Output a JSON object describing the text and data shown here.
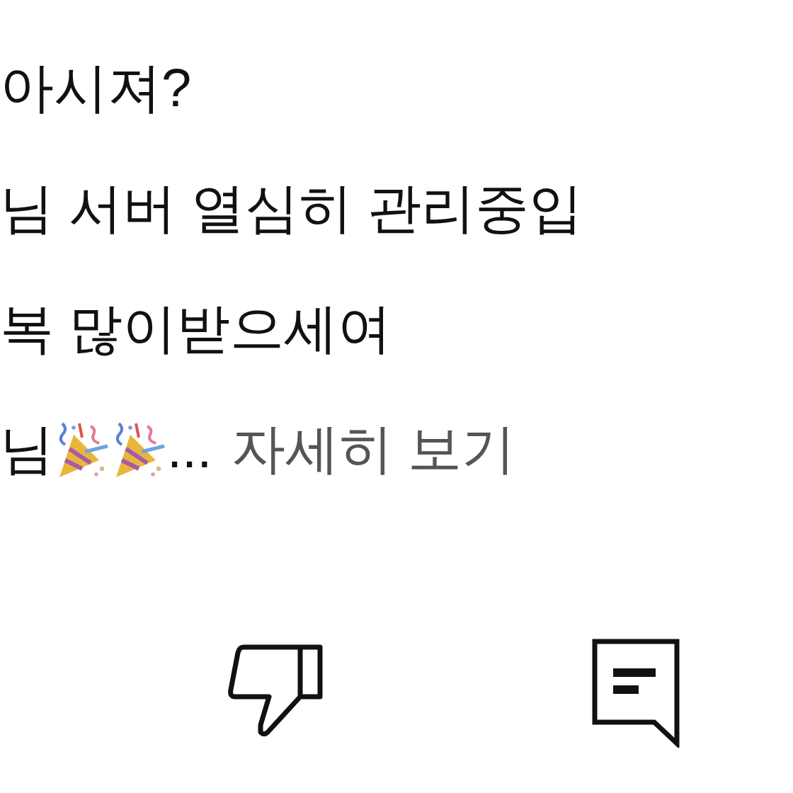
{
  "comment": {
    "lines": [
      "아시져?",
      "님 서버 열심히 관리중입",
      "복 많이받으세여"
    ],
    "last_line": {
      "text": "님",
      "ellipsis": "...",
      "more_link": "자세히 보기"
    }
  },
  "actions": [
    {
      "kind": "dislike"
    },
    {
      "kind": "reply"
    }
  ]
}
